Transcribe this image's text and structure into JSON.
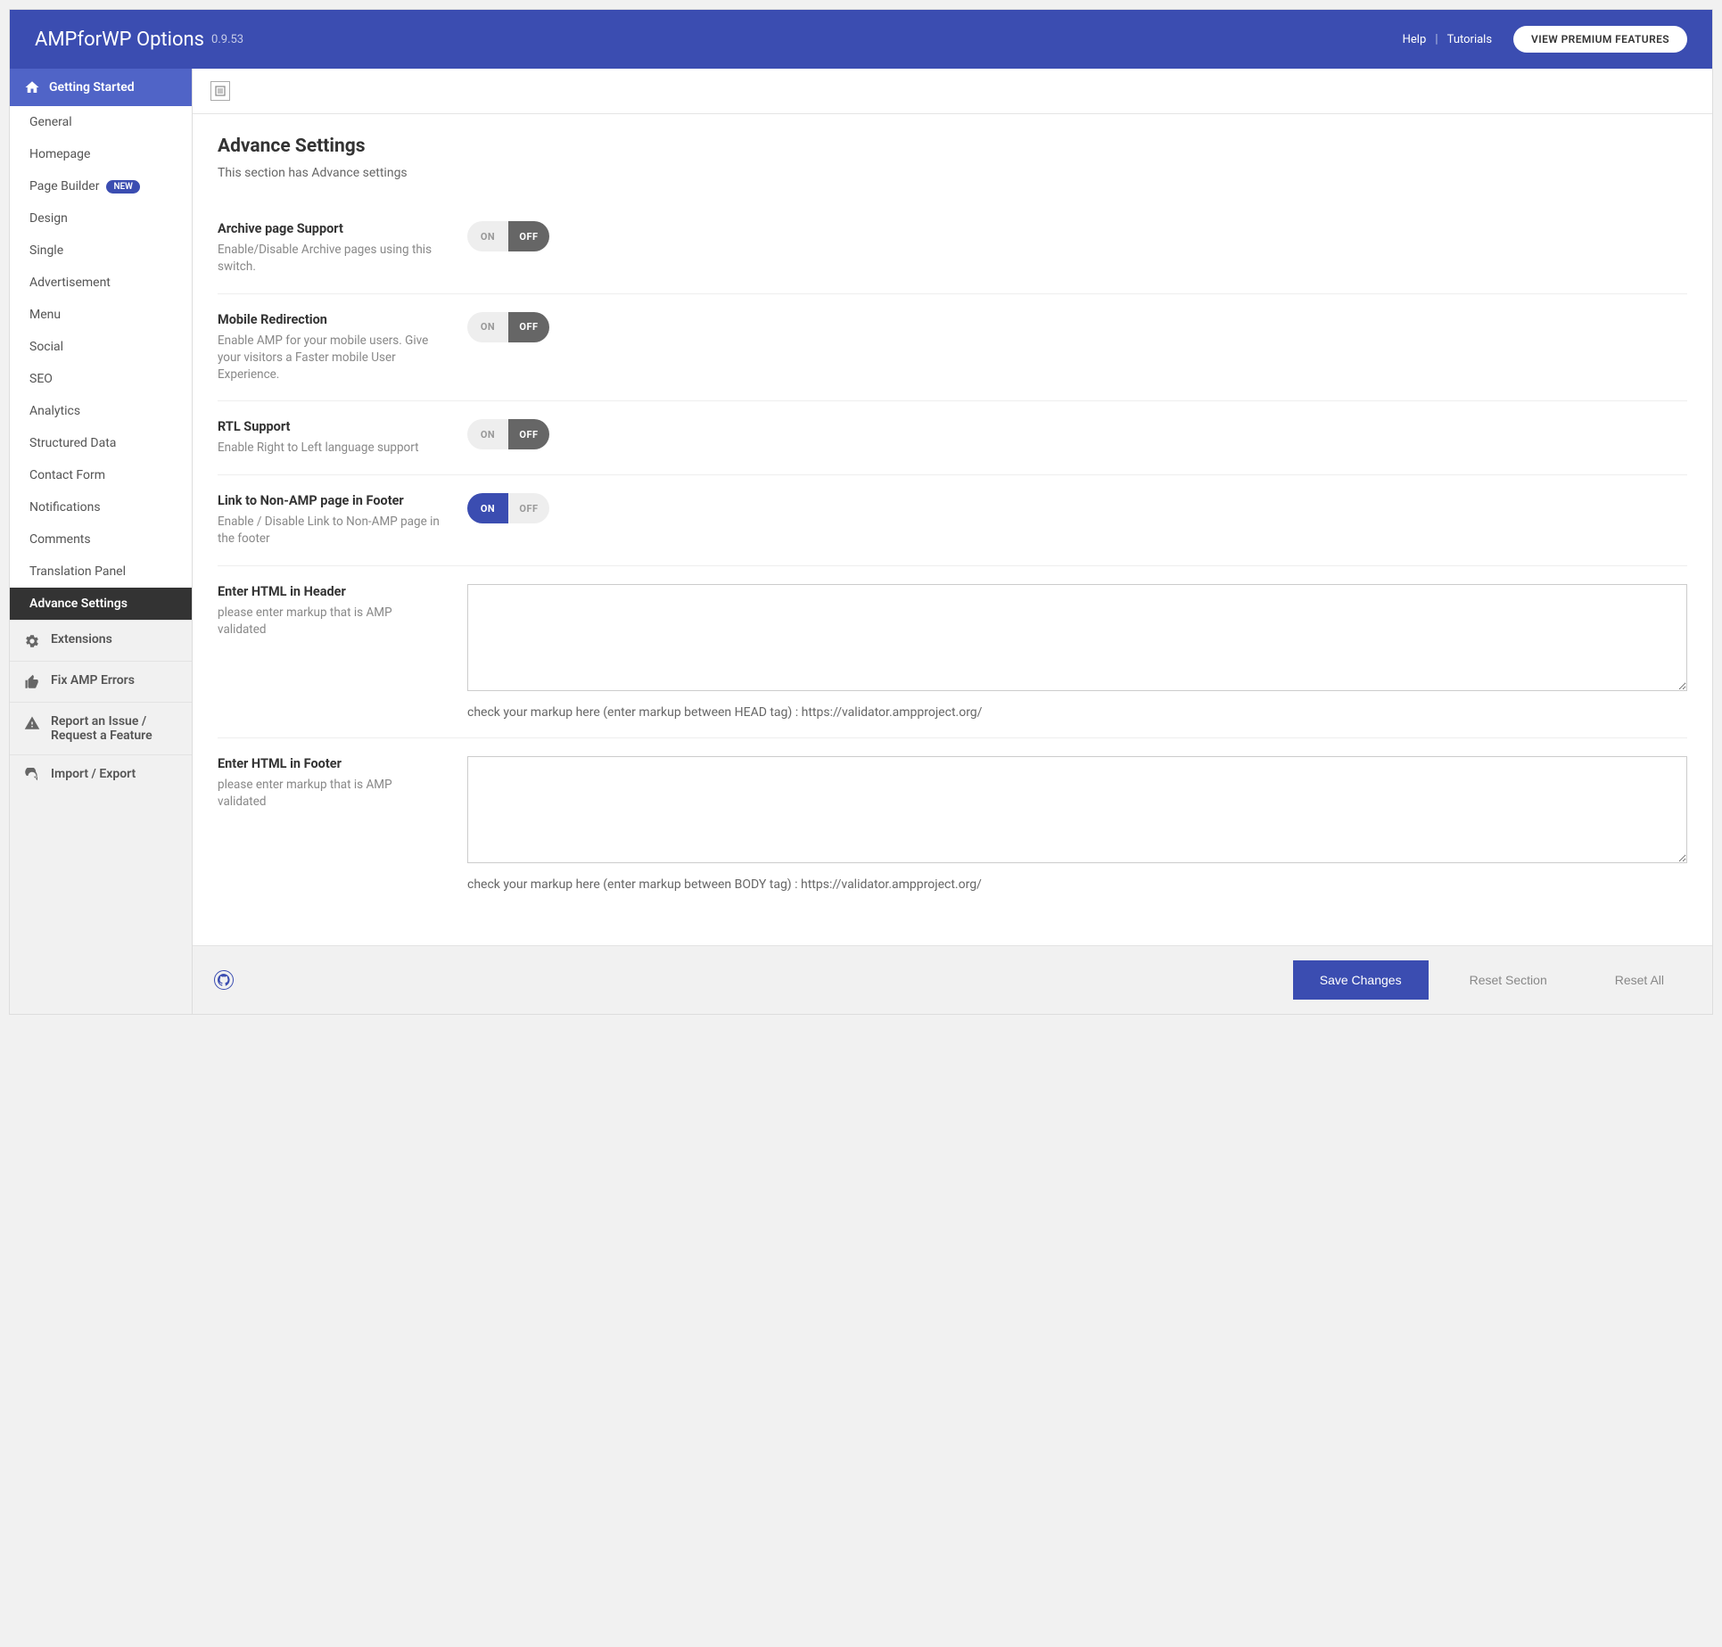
{
  "header": {
    "title": "AMPforWP Options",
    "version": "0.9.53",
    "help": "Help",
    "tutorials": "Tutorials",
    "premium": "VIEW PREMIUM FEATURES"
  },
  "sidebar": {
    "parent": "Getting Started",
    "items": [
      {
        "label": "General"
      },
      {
        "label": "Homepage"
      },
      {
        "label": "Page Builder",
        "badge": "NEW"
      },
      {
        "label": "Design"
      },
      {
        "label": "Single"
      },
      {
        "label": "Advertisement"
      },
      {
        "label": "Menu"
      },
      {
        "label": "Social"
      },
      {
        "label": "SEO"
      },
      {
        "label": "Analytics"
      },
      {
        "label": "Structured Data"
      },
      {
        "label": "Contact Form"
      },
      {
        "label": "Notifications"
      },
      {
        "label": "Comments"
      },
      {
        "label": "Translation Panel"
      },
      {
        "label": "Advance Settings",
        "active": true
      }
    ],
    "sections": {
      "extensions": "Extensions",
      "fix_errors": "Fix AMP Errors",
      "report": "Report an Issue / Request a Feature",
      "import_export": "Import / Export"
    }
  },
  "page": {
    "title": "Advance Settings",
    "desc": "This section has Advance settings"
  },
  "fields": {
    "archive": {
      "label": "Archive page Support",
      "help": "Enable/Disable Archive pages using this switch.",
      "state": "off"
    },
    "mobile": {
      "label": "Mobile Redirection",
      "help": "Enable AMP for your mobile users. Give your visitors a Faster mobile User Experience.",
      "state": "off"
    },
    "rtl": {
      "label": "RTL Support",
      "help": "Enable Right to Left language support",
      "state": "off"
    },
    "nonamp": {
      "label": "Link to Non-AMP page in Footer",
      "help": "Enable / Disable Link to Non-AMP page in the footer",
      "state": "on"
    },
    "html_header": {
      "label": "Enter HTML in Header",
      "help": "please enter markup that is AMP validated",
      "note": "check your markup here (enter markup between HEAD tag) : https://validator.ampproject.org/",
      "value": ""
    },
    "html_footer": {
      "label": "Enter HTML in Footer",
      "help": "please enter markup that is AMP validated",
      "note": "check your markup here (enter markup between BODY tag) : https://validator.ampproject.org/",
      "value": ""
    }
  },
  "toggle_labels": {
    "on": "ON",
    "off": "OFF"
  },
  "footer": {
    "save": "Save Changes",
    "reset_section": "Reset Section",
    "reset_all": "Reset All"
  }
}
